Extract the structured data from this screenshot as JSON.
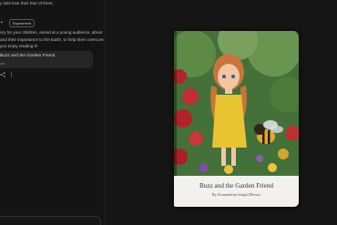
{
  "chat": {
    "top_text": "y kids lose their fear of them.",
    "avatar_glyph": "✦",
    "badge": "Experiment",
    "reply_lines": [
      "ory for your children, aimed at a young audience, about",
      "and their importance to the Earth, to help them overcome",
      "you enjoy reading it!"
    ],
    "card_title": "Buzz and the Garden Friend",
    "card_sub": "ow",
    "actions": [
      "share-icon",
      "more-icon"
    ]
  },
  "book": {
    "title": "Buzz and the Garden Friend",
    "author": "By Kanandeep Singh Dhesse"
  },
  "colors": {
    "background": "#141414",
    "card": "#262626",
    "cover_band": "#f2f1ee"
  }
}
